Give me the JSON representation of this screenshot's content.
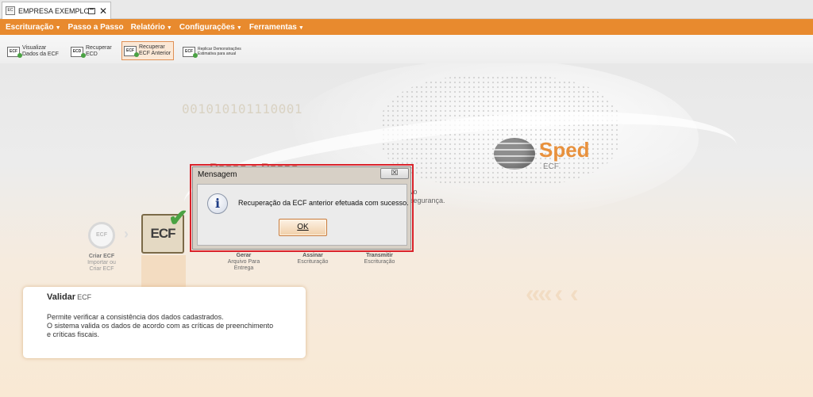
{
  "window": {
    "tab_title": "EMPRESA EXEMPLO...",
    "tab_icon": "EC",
    "close_glyph": "✕"
  },
  "menu": {
    "items": [
      {
        "label": "Escrituração"
      },
      {
        "label": "Passo a Passo"
      },
      {
        "label": "Relatório"
      },
      {
        "label": "Configurações"
      },
      {
        "label": "Ferramentas"
      }
    ],
    "caret": "▼",
    "color": "#e88a2e"
  },
  "toolbar": {
    "items": [
      {
        "icon": "ECF",
        "line1": "Visualizar",
        "line2": "Dados da ECF"
      },
      {
        "icon": "ECD",
        "line1": "Recuperar",
        "line2": "ECD"
      },
      {
        "icon": "ECF",
        "line1": "Recuperar",
        "line2": "ECF Anterior"
      },
      {
        "icon": "ECF",
        "line1": "Replicar Demonstrações",
        "line2": "Estimativa para anual"
      }
    ]
  },
  "background": {
    "binary_text": "001010101110001",
    "logo_word": "Sped",
    "logo_sub": "ECF",
    "faded_title": "Passo a Passo",
    "faded_line1": "vo",
    "faded_line2": "segurança."
  },
  "steps": {
    "criar": {
      "icon": "ECF",
      "title": "Criar ECF",
      "line2": "Importar ou",
      "line3": "Criar ECF"
    },
    "validar_icon": "ECF",
    "gerar": {
      "title": "Gerar",
      "line2": "Arquivo Para",
      "line3": "Entrega"
    },
    "assinar": {
      "title": "Assinar",
      "line2": "Escrituração"
    },
    "transmitir": {
      "title": "Transmitir",
      "line2": "Escrituração"
    }
  },
  "validar_panel": {
    "title": "Validar",
    "title_suffix": "ECF",
    "line1": "Permite verificar a consistência dos dados cadastrados.",
    "line2": "O sistema valida os dados de acordo com as críticas de preenchimento",
    "line3": "e críticas fiscais."
  },
  "dialog": {
    "title": "Mensagem",
    "close_glyph": "☒",
    "icon_glyph": "i",
    "message": "Recuperação da ECF anterior efetuada com sucesso.",
    "ok_label": "OK",
    "highlight_color": "#d9222a"
  }
}
